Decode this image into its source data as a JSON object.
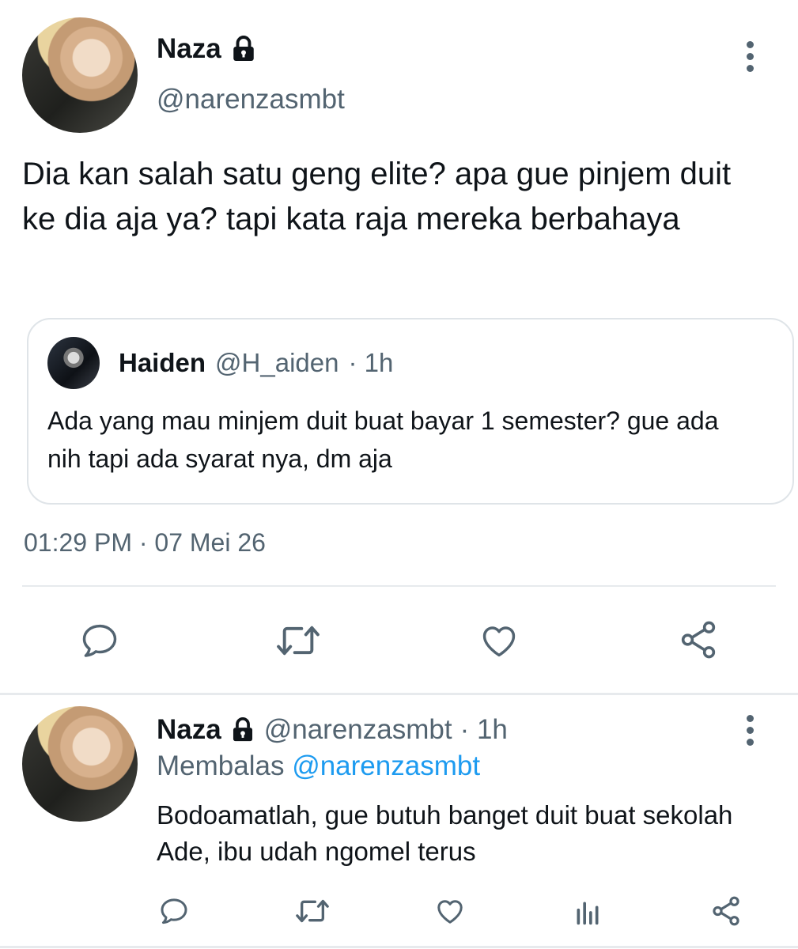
{
  "main_tweet": {
    "name": "Naza",
    "handle": "@narenzasmbt",
    "text": "Dia kan salah satu geng elite? apa gue pinjem duit ke dia aja ya? tapi kata raja mereka berbahaya",
    "timestamp": "01:29 PM · 07 Mei 26",
    "icons": [
      "lock-icon",
      "more-icon",
      "reply-icon",
      "retweet-icon",
      "like-icon",
      "share-icon"
    ]
  },
  "quoted_tweet": {
    "name": "Haiden",
    "handle": "@H_aiden",
    "time": "· 1h",
    "text": "Ada yang mau minjem duit buat bayar 1 semester? gue ada nih tapi ada syarat nya, dm aja"
  },
  "reply_tweet": {
    "name": "Naza",
    "handle": "@narenzasmbt",
    "time": "· 1h",
    "replying_label": "Membalas",
    "replying_to": "@narenzasmbt",
    "text": "Bodoamatlah, gue butuh banget duit buat sekolah Ade, ibu udah ngomel terus",
    "icons": [
      "reply-icon",
      "retweet-icon",
      "like-icon",
      "analytics-icon",
      "share-icon"
    ]
  },
  "colors": {
    "text": "#0f1419",
    "muted": "#536471",
    "link": "#1d9bf0",
    "divider": "#e7eaed"
  }
}
